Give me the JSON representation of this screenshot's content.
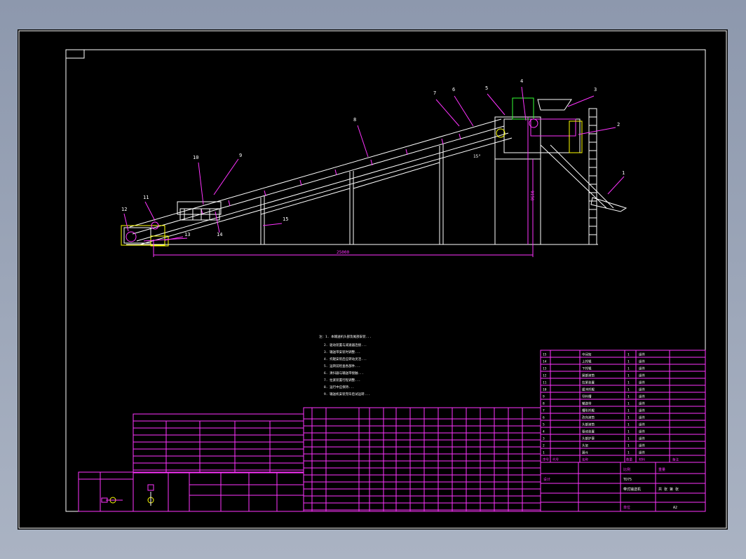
{
  "drawing": {
    "balloons": [
      "1",
      "2",
      "3",
      "4",
      "5",
      "6",
      "7",
      "8",
      "9",
      "10",
      "11",
      "12",
      "13",
      "14",
      "15"
    ],
    "dimensions": {
      "horizontal": "25000",
      "vertical": "9156",
      "angle": "15°"
    },
    "notes": [
      "注：1. 本输送机头部及尾部安装...",
      "2. 驱动装置与减速器连接...",
      "3. 输送带安装时调整...",
      "4. 托辊安装后应转动灵活...",
      "5. 运转前检查各部件...",
      "6. 清扫器与输送带接触...",
      "7. 拉紧装置行程调整...",
      "8. 运行中应保持...",
      "9. 输送机安装完毕后试运转..."
    ],
    "title_block": {
      "design_label": "设计",
      "scale_label": "比例",
      "weight_label": "重量",
      "sheet_label": "共  张 第  张",
      "drawing_no": "TD75",
      "title": "带式输送机",
      "material": "A2",
      "unit_label": "单位"
    },
    "parts_table": {
      "headers": [
        "序号",
        "代号",
        "名称",
        "数量",
        "材料",
        "备注"
      ],
      "rows": [
        {
          "no": "15",
          "name": "中间架",
          "qty": "1",
          "mat": "组件"
        },
        {
          "no": "14",
          "name": "上托辊",
          "qty": "1",
          "mat": "组件"
        },
        {
          "no": "13",
          "name": "下托辊",
          "qty": "1",
          "mat": "组件"
        },
        {
          "no": "12",
          "name": "尾部滚筒",
          "qty": "1",
          "mat": "组件"
        },
        {
          "no": "11",
          "name": "拉紧装置",
          "qty": "1",
          "mat": "组件"
        },
        {
          "no": "10",
          "name": "缓冲托辊",
          "qty": "1",
          "mat": "组件"
        },
        {
          "no": "9",
          "name": "导料槽",
          "qty": "1",
          "mat": "组件"
        },
        {
          "no": "8",
          "name": "输送带",
          "qty": "1",
          "mat": "组件"
        },
        {
          "no": "7",
          "name": "槽形托辊",
          "qty": "1",
          "mat": "组件"
        },
        {
          "no": "6",
          "name": "改向滚筒",
          "qty": "1",
          "mat": "组件"
        },
        {
          "no": "5",
          "name": "头部滚筒",
          "qty": "1",
          "mat": "组件"
        },
        {
          "no": "4",
          "name": "驱动装置",
          "qty": "1",
          "mat": "组件"
        },
        {
          "no": "3",
          "name": "头部护罩",
          "qty": "1",
          "mat": "组件"
        },
        {
          "no": "2",
          "name": "头架",
          "qty": "1",
          "mat": "组件"
        },
        {
          "no": "1",
          "name": "漏斗",
          "qty": "1",
          "mat": "组件"
        }
      ]
    }
  },
  "colors": {
    "canvas": "#000000",
    "line": "#ffffff",
    "table": "#ff33ff",
    "highlight": "#ffff00",
    "green": "#33ff33"
  }
}
